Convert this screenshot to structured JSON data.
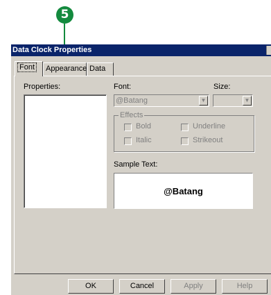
{
  "callout": {
    "number": "5"
  },
  "dialog": {
    "title": "Data Clock Properties",
    "tabs": [
      {
        "label": "Font"
      },
      {
        "label": "Appearance"
      },
      {
        "label": "Data"
      }
    ],
    "properties_label": "Properties:",
    "font_label": "Font:",
    "font_value": "@Batang",
    "size_label": "Size:",
    "size_value": "",
    "effects": {
      "title": "Effects",
      "bold": "Bold",
      "underline": "Underline",
      "italic": "Italic",
      "strikeout": "Strikeout"
    },
    "sample_label": "Sample Text:",
    "sample_text": "@Batang",
    "buttons": {
      "ok": "OK",
      "cancel": "Cancel",
      "apply": "Apply",
      "help": "Help"
    },
    "icons": {
      "dropdown": "chevron-down-icon",
      "close": "close-icon"
    }
  }
}
